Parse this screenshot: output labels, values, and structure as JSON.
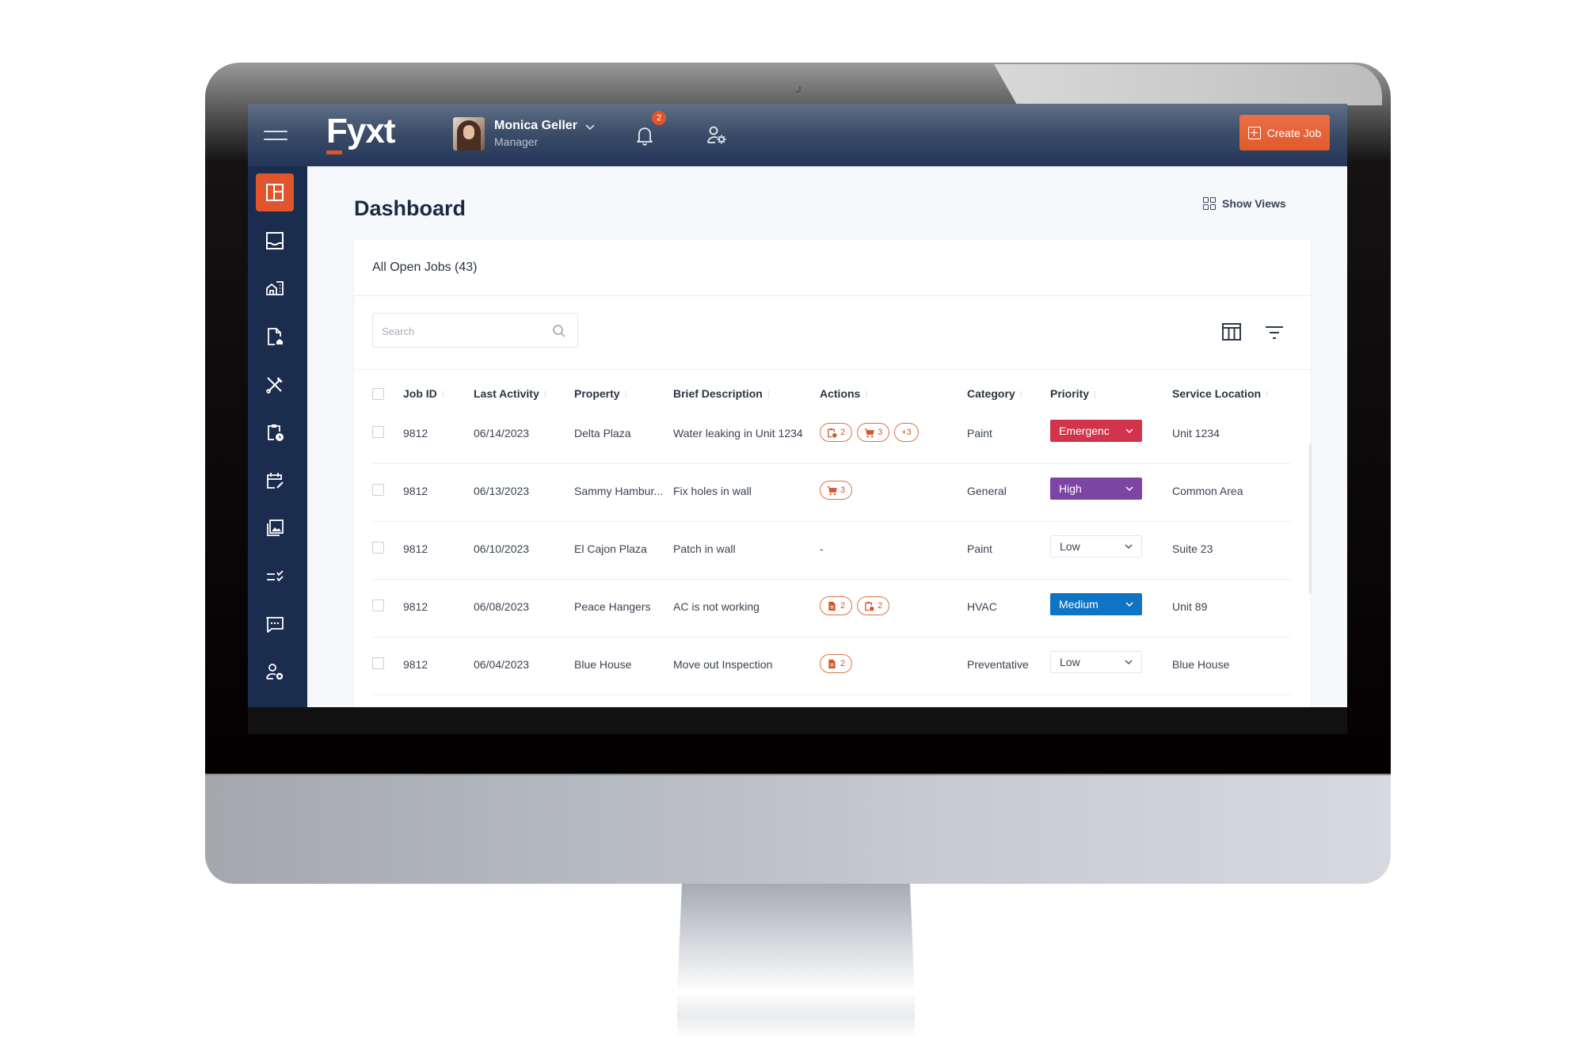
{
  "app": {
    "logo": "Fyxt",
    "brand_color": "#e0552b",
    "topbar_color": "#23355a",
    "sidebar_color": "#1b2d4e"
  },
  "header": {
    "user": {
      "name": "Monica Geller",
      "role": "Manager"
    },
    "notification_count": "2",
    "create_job_label": "Create Job"
  },
  "sidebar": {
    "items": [
      {
        "icon": "dashboard-icon",
        "label": "Dashboard",
        "active": true
      },
      {
        "icon": "inbox-icon",
        "label": "Inbox"
      },
      {
        "icon": "properties-icon",
        "label": "Properties"
      },
      {
        "icon": "leases-icon",
        "label": "Leases"
      },
      {
        "icon": "jobs-tools-icon",
        "label": "Jobs"
      },
      {
        "icon": "schedule-clipboard-icon",
        "label": "Planned Maintenance"
      },
      {
        "icon": "calendar-edit-icon",
        "label": "Calendar"
      },
      {
        "icon": "gallery-icon",
        "label": "Gallery"
      },
      {
        "icon": "checklist-icon",
        "label": "Checklists"
      },
      {
        "icon": "chat-icon",
        "label": "Messages"
      },
      {
        "icon": "user-settings-icon",
        "label": "Settings"
      }
    ]
  },
  "main": {
    "title": "Dashboard",
    "show_views_label": "Show Views",
    "card": {
      "title": "All Open Jobs  (43)",
      "search_placeholder": "Search",
      "search_value": "",
      "columns": [
        "Job ID",
        "Last Activity",
        "Property",
        "Brief Description",
        "Actions",
        "Category",
        "Priority",
        "Service Location"
      ],
      "rows": [
        {
          "job_id": "9812",
          "last_activity": "06/14/2023",
          "property": "Delta Plaza",
          "description": "Water leaking in Unit 1234",
          "actions": [
            {
              "icon": "clipboard-clock-icon",
              "count": "2"
            },
            {
              "icon": "cart-icon",
              "count": "3"
            },
            {
              "icon": "",
              "count": "+3"
            }
          ],
          "category": "Paint",
          "priority": "Emergenc",
          "priority_color": "#d1344b",
          "priority_style": "filled",
          "location": "Unit 1234"
        },
        {
          "job_id": "9812",
          "last_activity": "06/13/2023",
          "property": "Sammy Hambur...",
          "description": "Fix holes in wall",
          "actions": [
            {
              "icon": "cart-icon",
              "count": "3"
            }
          ],
          "category": "General",
          "priority": "High",
          "priority_color": "#7d45a3",
          "priority_style": "filled",
          "location": "Common Area"
        },
        {
          "job_id": "9812",
          "last_activity": "06/10/2023",
          "property": "El Cajon Plaza",
          "description": "Patch in wall",
          "actions": [],
          "actions_empty": "-",
          "category": "Paint",
          "priority": "Low",
          "priority_color": "#ffffff",
          "priority_style": "outline",
          "location": "Suite 23"
        },
        {
          "job_id": "9812",
          "last_activity": "06/08/2023",
          "property": "Peace Hangers",
          "description": "AC is not working",
          "actions": [
            {
              "icon": "document-icon",
              "count": "2"
            },
            {
              "icon": "clipboard-clock-icon",
              "count": "2"
            }
          ],
          "category": "HVAC",
          "priority": "Medium",
          "priority_color": "#0f74c4",
          "priority_style": "filled",
          "location": "Unit 89"
        },
        {
          "job_id": "9812",
          "last_activity": "06/04/2023",
          "property": "Blue House",
          "description": "Move out Inspection",
          "actions": [
            {
              "icon": "document-icon",
              "count": "2"
            }
          ],
          "category": "Preventative",
          "priority": "Low",
          "priority_color": "#ffffff",
          "priority_style": "outline",
          "location": "Blue House"
        }
      ]
    }
  }
}
